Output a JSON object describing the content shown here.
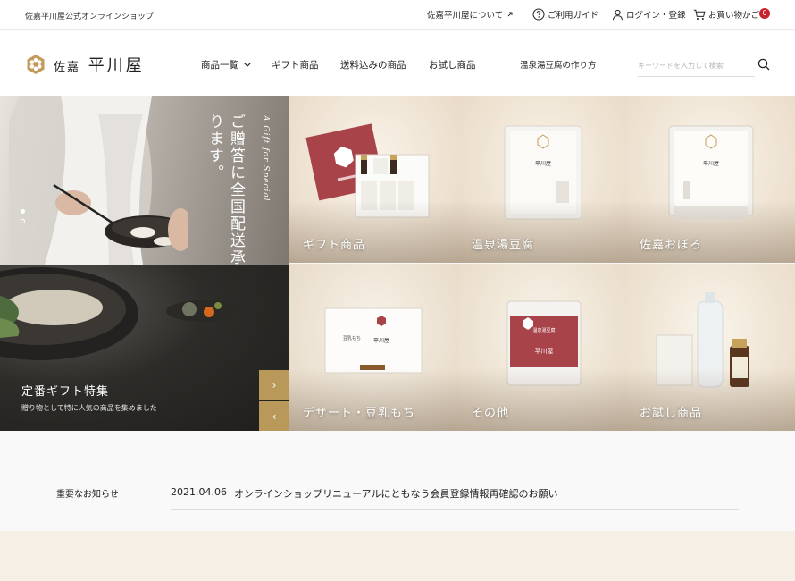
{
  "topbar": {
    "shop_name": "佐嘉平川屋公式オンラインショップ",
    "about": "佐嘉平川屋について",
    "guide": "ご利用ガイド",
    "login": "ログイン・登録",
    "cart": "お買い物かご",
    "cart_count": "0"
  },
  "header": {
    "logo_small": "佐嘉",
    "logo_main": "平川屋",
    "nav": {
      "products": "商品一覧",
      "gifts": "ギフト商品",
      "free_shipping": "送料込みの商品",
      "trial": "お試し商品",
      "how_made": "温泉湯豆腐の作り方"
    },
    "search_placeholder": "キーワードを入力して検索"
  },
  "hero": {
    "copy": "ご贈答に全国配送承ります。",
    "subcopy": "A Gift for Special"
  },
  "feature": {
    "title": "定番ギフト特集",
    "description": "贈り物として特に人気の商品を集めました",
    "next": "›",
    "prev": "‹"
  },
  "categories": [
    {
      "label": "ギフト商品"
    },
    {
      "label": "温泉湯豆腐"
    },
    {
      "label": "佐嘉おぼろ"
    },
    {
      "label": "デザート・豆乳もち"
    },
    {
      "label": "その他"
    },
    {
      "label": "お試し商品"
    }
  ],
  "packaging_text": {
    "brand": "平川屋",
    "tofu": "温泉湯豆腐",
    "mochi": "豆乳もち"
  },
  "notice": {
    "heading": "重要なお知らせ",
    "date": "2021.04.06",
    "text": "オンラインショップリニューアルにともなう会員登録情報再確認のお願い"
  },
  "colors": {
    "accent_gold": "#b9995a",
    "badge_red": "#c8232c",
    "seal_red": "#a8434a"
  }
}
